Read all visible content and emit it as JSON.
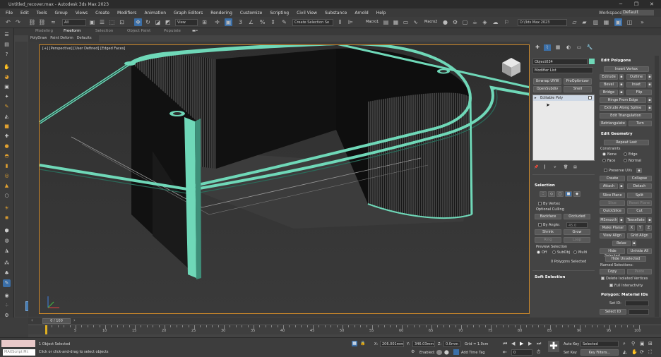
{
  "window": {
    "title": "Untitled_recover.max - Autodesk 3ds Max 2023",
    "min": "─",
    "max": "❐",
    "close": "✕"
  },
  "menu": [
    "File",
    "Edit",
    "Tools",
    "Group",
    "Views",
    "Create",
    "Modifiers",
    "Animation",
    "Graph Editors",
    "Rendering",
    "Customize",
    "Scripting",
    "Civil View",
    "Substance",
    "Arnold",
    "Help"
  ],
  "workspaces": {
    "label": "Workspaces:",
    "value": "Default"
  },
  "toolbar": {
    "filter": "All",
    "view": "View",
    "selection_set": "Create Selection Se",
    "macro1": "Macro1",
    "macro2": "Macro2",
    "project": "D:\\3ds Max 2023"
  },
  "ribbon": {
    "tabs": [
      "Modeling",
      "Freeform",
      "Selection",
      "Object Paint",
      "Populate"
    ],
    "active": "Freeform",
    "subtabs": [
      "PolyDraw",
      "Paint Deform",
      "Defaults"
    ]
  },
  "viewport": {
    "label": "[+] [Perspective] [User Defined] [Edged Faces]"
  },
  "command_panel": {
    "object_name": "Object034",
    "modifier_list": "Modifier List",
    "buttons": [
      "Unwrap UVW",
      "ProOptimizer",
      "OpenSubdiv",
      "Shell"
    ],
    "stack_item": "Editable Poly",
    "selection": {
      "title": "Selection",
      "by_vertex": "By Vertex",
      "optional_culling": "Optional Culling",
      "backface": "Backface",
      "occluded": "Occluded",
      "by_angle": "By Angle:",
      "angle_value": "45.0",
      "shrink": "Shrink",
      "grow": "Grow",
      "ring": "Ring",
      "loop": "Loop",
      "preview": "Preview Selection",
      "off": "Off",
      "subobj": "SubObj",
      "multi": "Multi",
      "status": "0 Polygons Selected"
    },
    "soft_selection": "Soft Selection"
  },
  "edit_polygons": {
    "title": "Edit Polygons",
    "insert_vertex": "Insert Vertex",
    "extrude": "Extrude",
    "outline": "Outline",
    "bevel": "Bevel",
    "inset": "Inset",
    "bridge": "Bridge",
    "flip": "Flip",
    "hinge": "Hinge From Edge",
    "extrude_spline": "Extrude Along Spline",
    "edit_tri": "Edit Triangulation",
    "retriangulate": "Retriangulate",
    "turn": "Turn"
  },
  "edit_geometry": {
    "title": "Edit Geometry",
    "repeat_last": "Repeat Last",
    "constraints": "Constraints",
    "none": "None",
    "edge": "Edge",
    "face": "Face",
    "normal": "Normal",
    "preserve_uvs": "Preserve UVs",
    "create": "Create",
    "collapse": "Collapse",
    "attach": "Attach",
    "detach": "Detach",
    "slice_plane": "Slice Plane",
    "split": "Split",
    "slice": "Slice",
    "reset_plane": "Reset Plane",
    "quickslice": "QuickSlice",
    "cut": "Cut",
    "msmooth": "MSmooth",
    "tessellate": "Tessellate",
    "make_planar": "Make Planar",
    "x": "X",
    "y": "Y",
    "z": "Z",
    "view_align": "View Align",
    "grid_align": "Grid Align",
    "relax": "Relax",
    "hide_selected": "Hide Selected",
    "unhide_all": "Unhide All",
    "hide_unselected": "Hide Unselected",
    "named_selections": "Named Selections:",
    "copy": "Copy",
    "paste": "Paste",
    "delete_isolated": "Delete Isolated Vertices",
    "full_interactivity": "Full Interactivity"
  },
  "material_ids": {
    "title": "Polygon: Material IDs",
    "set_id": "Set ID:",
    "select_id": "Select ID"
  },
  "timeline": {
    "slider": "0 / 100",
    "ticks": [
      "0",
      "5",
      "10",
      "15",
      "20",
      "25",
      "30",
      "35",
      "40",
      "45",
      "50",
      "55",
      "60",
      "65",
      "70",
      "75",
      "80",
      "85",
      "90",
      "95",
      "100"
    ]
  },
  "status": {
    "maxscript": "MAXScript Mi:",
    "selected": "1 Object Selected",
    "prompt": "Click or click-and-drag to select objects",
    "x_label": "X:",
    "x_value": "206.001mm",
    "y_label": "Y:",
    "y_value": "346.03mm",
    "z_label": "Z:",
    "z_value": "0.0mm",
    "grid": "Grid = 1.0cm",
    "enabled": "Enabled:",
    "add_time_tag": "Add Time Tag",
    "frame": "0",
    "auto_key": "Auto Key",
    "selected_dd": "Selected",
    "set_key": "Set Key",
    "key_filters": "Key Filters..."
  },
  "colors": {
    "accent": "#d08a2a",
    "mesh": "#6fd8b8",
    "panel": "#444444"
  }
}
